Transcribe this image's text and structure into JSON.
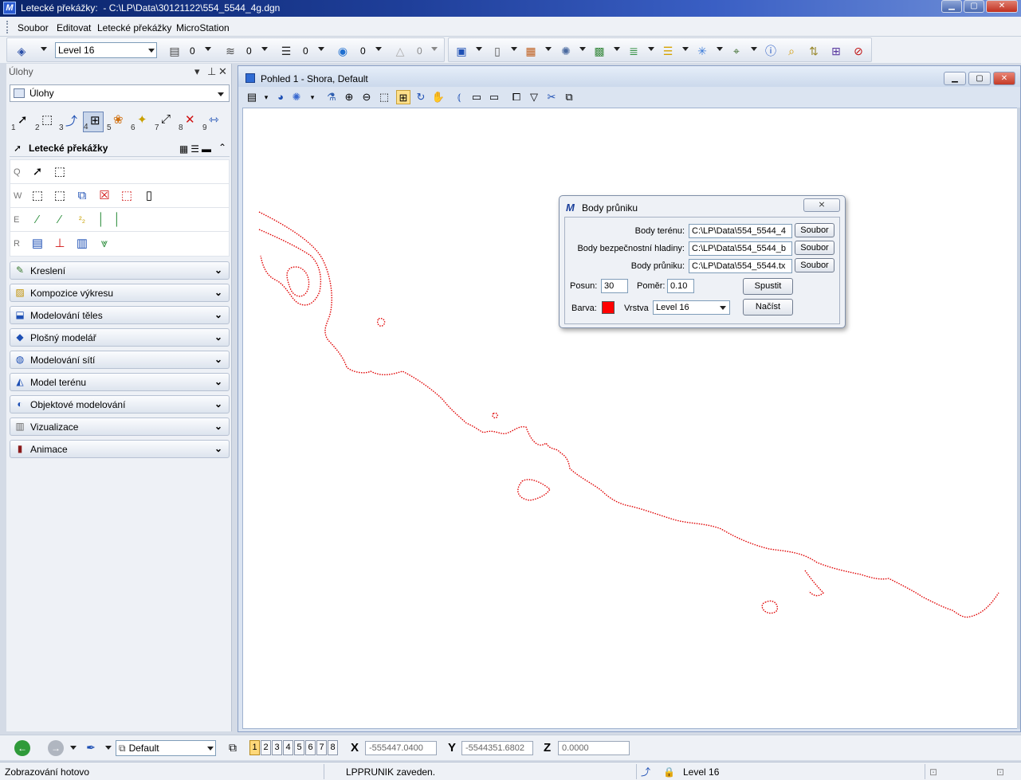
{
  "window": {
    "title": "Letecké překážky:  - C:\\LP\\Data\\30121122\\554_5544_4g.dgn"
  },
  "menu": [
    "Soubor",
    "Editovat",
    "Letecké překážky",
    "MicroStation"
  ],
  "toolbar": {
    "level_select": "Level 16",
    "color_value": "0",
    "linestyle_value": "0",
    "weight_value": "0",
    "transparency_value": "0",
    "priority_value": "0"
  },
  "tasks_panel": {
    "title": "Úlohy",
    "combo_value": "Úlohy",
    "numbered_tools": [
      "1",
      "2",
      "3",
      "4",
      "5",
      "6",
      "7",
      "8",
      "9"
    ],
    "section_title": "Letecké překážky",
    "row_keys": [
      "Q",
      "W",
      "E",
      "R"
    ],
    "accordion": [
      {
        "label": "Kreslení",
        "icon": "pencil-icon"
      },
      {
        "label": "Kompozice výkresu",
        "icon": "layout-icon"
      },
      {
        "label": "Modelování těles",
        "icon": "solid-icon"
      },
      {
        "label": "Plošný modelář",
        "icon": "surface-icon"
      },
      {
        "label": "Modelování sítí",
        "icon": "mesh-icon"
      },
      {
        "label": "Model terénu",
        "icon": "terrain-icon"
      },
      {
        "label": "Objektové modelování",
        "icon": "object-icon"
      },
      {
        "label": "Vizualizace",
        "icon": "visualize-icon"
      },
      {
        "label": "Animace",
        "icon": "film-icon"
      }
    ]
  },
  "view": {
    "title": "Pohled 1 - Shora, Default",
    "line_color": "#e00000"
  },
  "dialog": {
    "title": "Body průniku",
    "close_label": "⨯",
    "rows": [
      {
        "label": "Body terénu:",
        "value": "C:\\LP\\Data\\554_5544_4",
        "button": "Soubor"
      },
      {
        "label": "Body bezpečnostní hladiny:",
        "value": "C:\\LP\\Data\\554_5544_b",
        "button": "Soubor"
      },
      {
        "label": "Body průniku:",
        "value": "C:\\LP\\Data\\554_5544.tx",
        "button": "Soubor"
      }
    ],
    "posun_label": "Posun:",
    "posun_value": "30",
    "pomer_label": "Poměr:",
    "pomer_value": "0.10",
    "run_button": "Spustit",
    "barva_label": "Barva:",
    "barva_color": "#ff0000",
    "vrstva_label": "Vrstva",
    "vrstva_value": "Level 16",
    "load_button": "Načíst"
  },
  "bottom_toolbar": {
    "view_group": "Default",
    "view_numbers": [
      "1",
      "2",
      "3",
      "4",
      "5",
      "6",
      "7",
      "8"
    ],
    "active_view": "1",
    "x_label": "X",
    "x_value": "-555447.0400",
    "y_label": "Y",
    "y_value": "-5544351.6802",
    "z_label": "Z",
    "z_value": "0.0000"
  },
  "status": {
    "left": "Zobrazování hotovo",
    "message": "LPPRUNIK zaveden.",
    "level": "Level 16"
  }
}
